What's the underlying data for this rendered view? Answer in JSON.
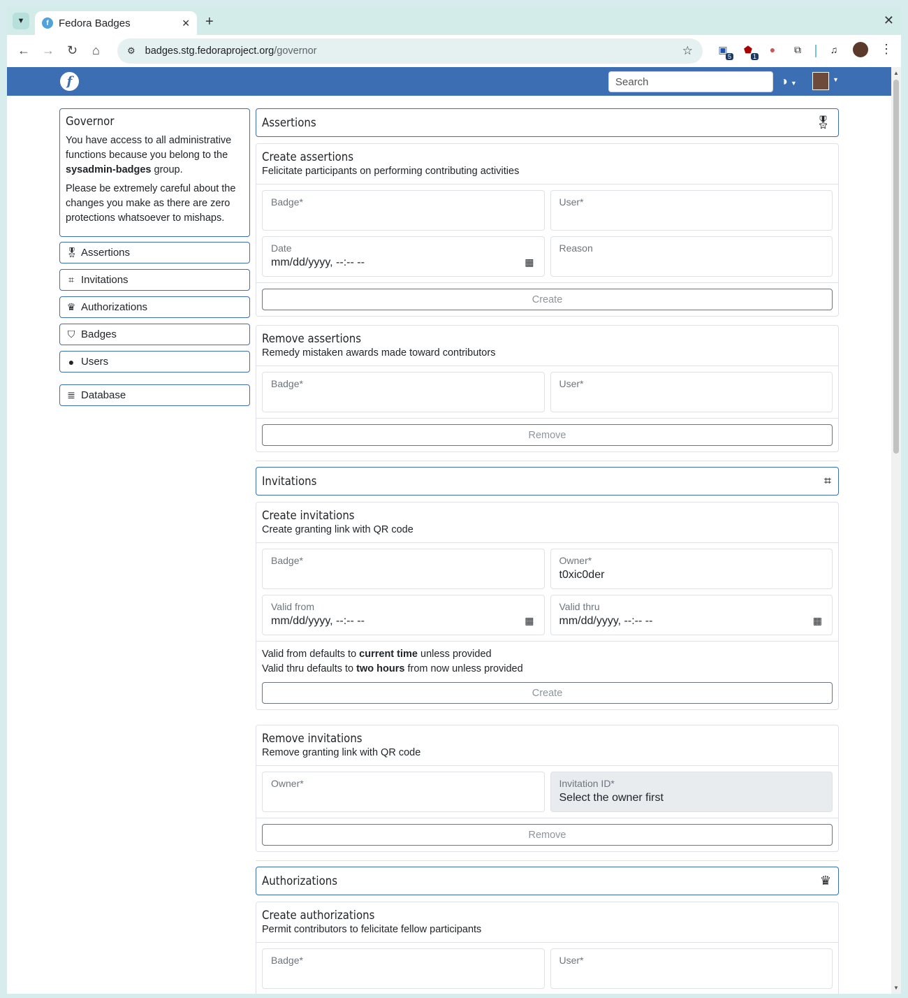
{
  "browser": {
    "tab_title": "Fedora Badges",
    "url_host": "badges.stg.fedoraproject.org",
    "url_path": "/governor",
    "ext_badge_1": "5",
    "ext_badge_2": "1"
  },
  "navbar": {
    "search_placeholder": "Search"
  },
  "governor": {
    "title": "Governor",
    "p1_before": "You have access to all administrative functions because you belong to the ",
    "p1_group": "sysadmin-badges",
    "p1_after": " group.",
    "p2": "Please be extremely careful about the changes you make as there are zero protections whatsoever to mishaps."
  },
  "sidebar": {
    "items": [
      {
        "label": "Assertions",
        "icon": "medal-icon"
      },
      {
        "label": "Invitations",
        "icon": "qr-icon"
      },
      {
        "label": "Authorizations",
        "icon": "crown-icon"
      },
      {
        "label": "Badges",
        "icon": "shield-star-icon"
      },
      {
        "label": "Users",
        "icon": "user-circle-icon"
      },
      {
        "label": "Database",
        "icon": "database-icon"
      }
    ]
  },
  "assertions": {
    "title": "Assertions",
    "create": {
      "title": "Create assertions",
      "subtitle": "Felicitate participants on performing contributing activities",
      "badge_label": "Badge*",
      "user_label": "User*",
      "date_label": "Date",
      "date_value": "mm/dd/yyyy, --:-- --",
      "reason_label": "Reason",
      "button": "Create"
    },
    "remove": {
      "title": "Remove assertions",
      "subtitle": "Remedy mistaken awards made toward contributors",
      "badge_label": "Badge*",
      "user_label": "User*",
      "button": "Remove"
    }
  },
  "invitations": {
    "title": "Invitations",
    "create": {
      "title": "Create invitations",
      "subtitle": "Create granting link with QR code",
      "badge_label": "Badge*",
      "owner_label": "Owner*",
      "owner_value": "t0xic0der",
      "valid_from_label": "Valid from",
      "valid_from_value": "mm/dd/yyyy, --:-- --",
      "valid_thru_label": "Valid thru",
      "valid_thru_value": "mm/dd/yyyy, --:-- --",
      "note1_a": "Valid from defaults to ",
      "note1_b": "current time",
      "note1_c": " unless provided",
      "note2_a": "Valid thru defaults to ",
      "note2_b": "two hours",
      "note2_c": " from now unless provided",
      "button": "Create"
    },
    "remove": {
      "title": "Remove invitations",
      "subtitle": "Remove granting link with QR code",
      "owner_label": "Owner*",
      "invitation_label": "Invitation ID*",
      "invitation_value": "Select the owner first",
      "button": "Remove"
    }
  },
  "authorizations": {
    "title": "Authorizations",
    "create": {
      "title": "Create authorizations",
      "subtitle": "Permit contributors to felicitate fellow participants",
      "badge_label": "Badge*",
      "user_label": "User*"
    }
  }
}
